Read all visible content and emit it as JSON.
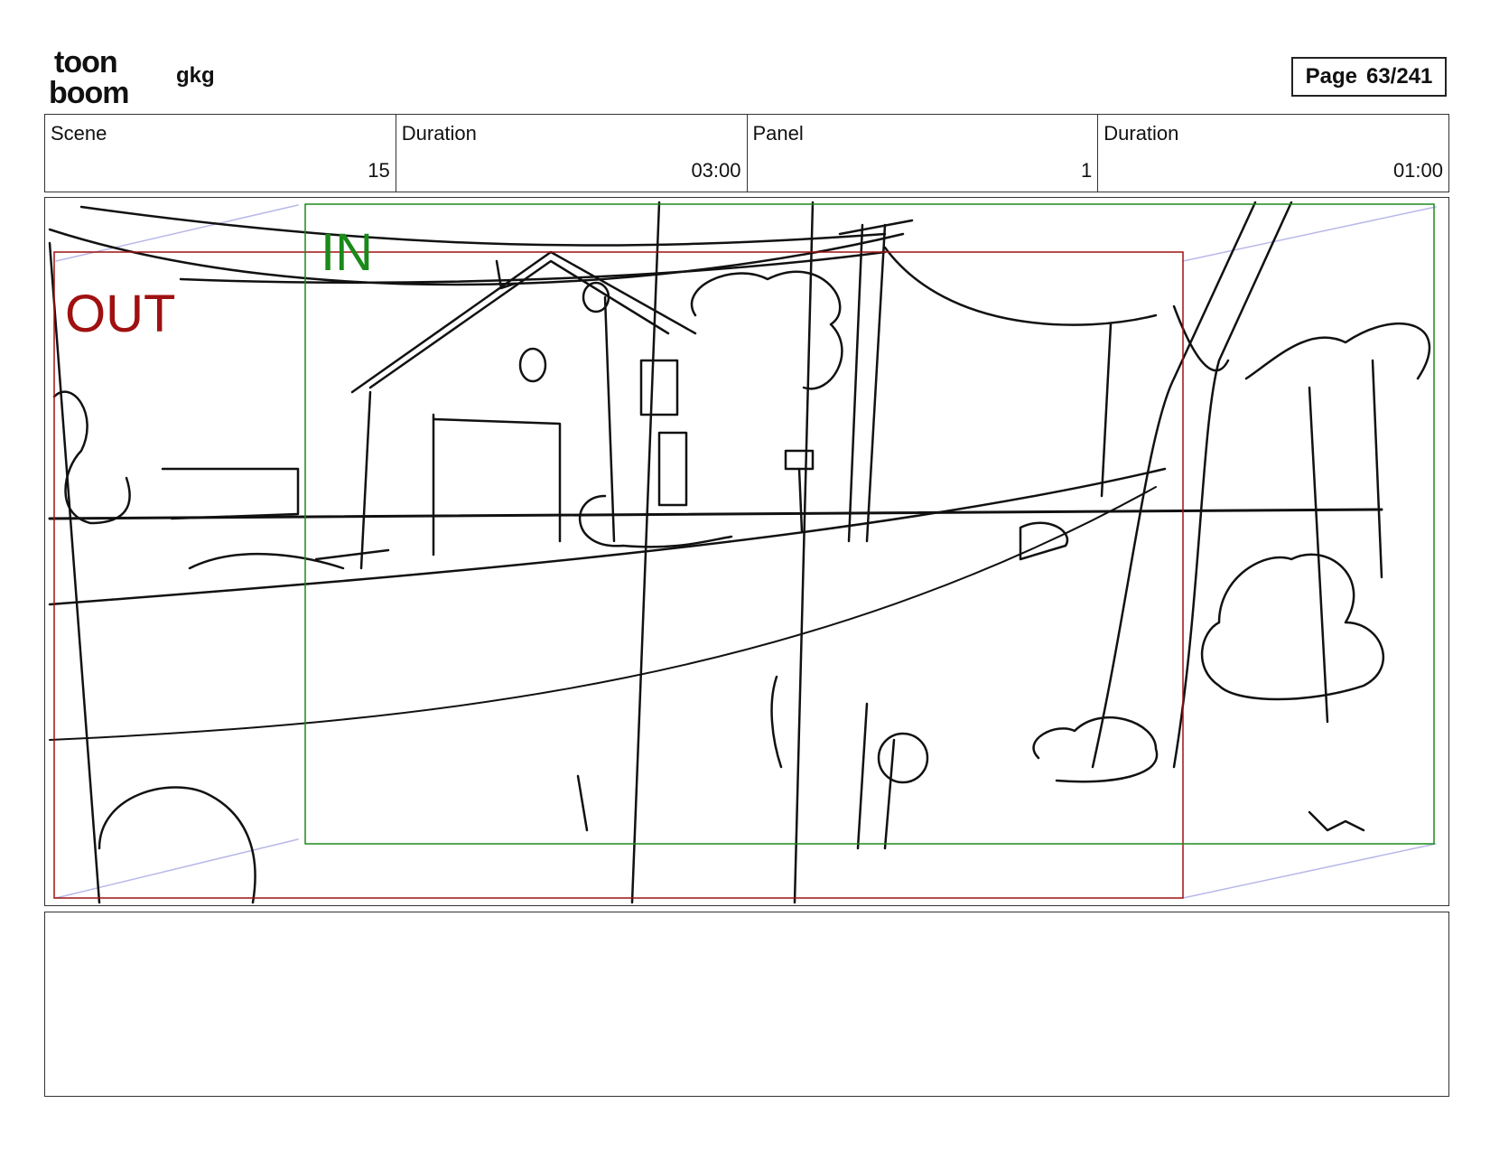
{
  "header": {
    "logo_line1": "toon",
    "logo_line2": "boom",
    "project_title": "gkg",
    "page_label": "Page",
    "page_number": "63/241"
  },
  "info": {
    "scene_label": "Scene",
    "scene_value": "15",
    "scene_duration_label": "Duration",
    "scene_duration_value": "03:00",
    "panel_label": "Panel",
    "panel_value": "1",
    "panel_duration_label": "Duration",
    "panel_duration_value": "01:00"
  },
  "panel": {
    "in_label": "IN",
    "out_label": "OUT",
    "in_color": "#1a8a1a",
    "out_color": "#a01010"
  },
  "notes": {
    "text": ""
  }
}
